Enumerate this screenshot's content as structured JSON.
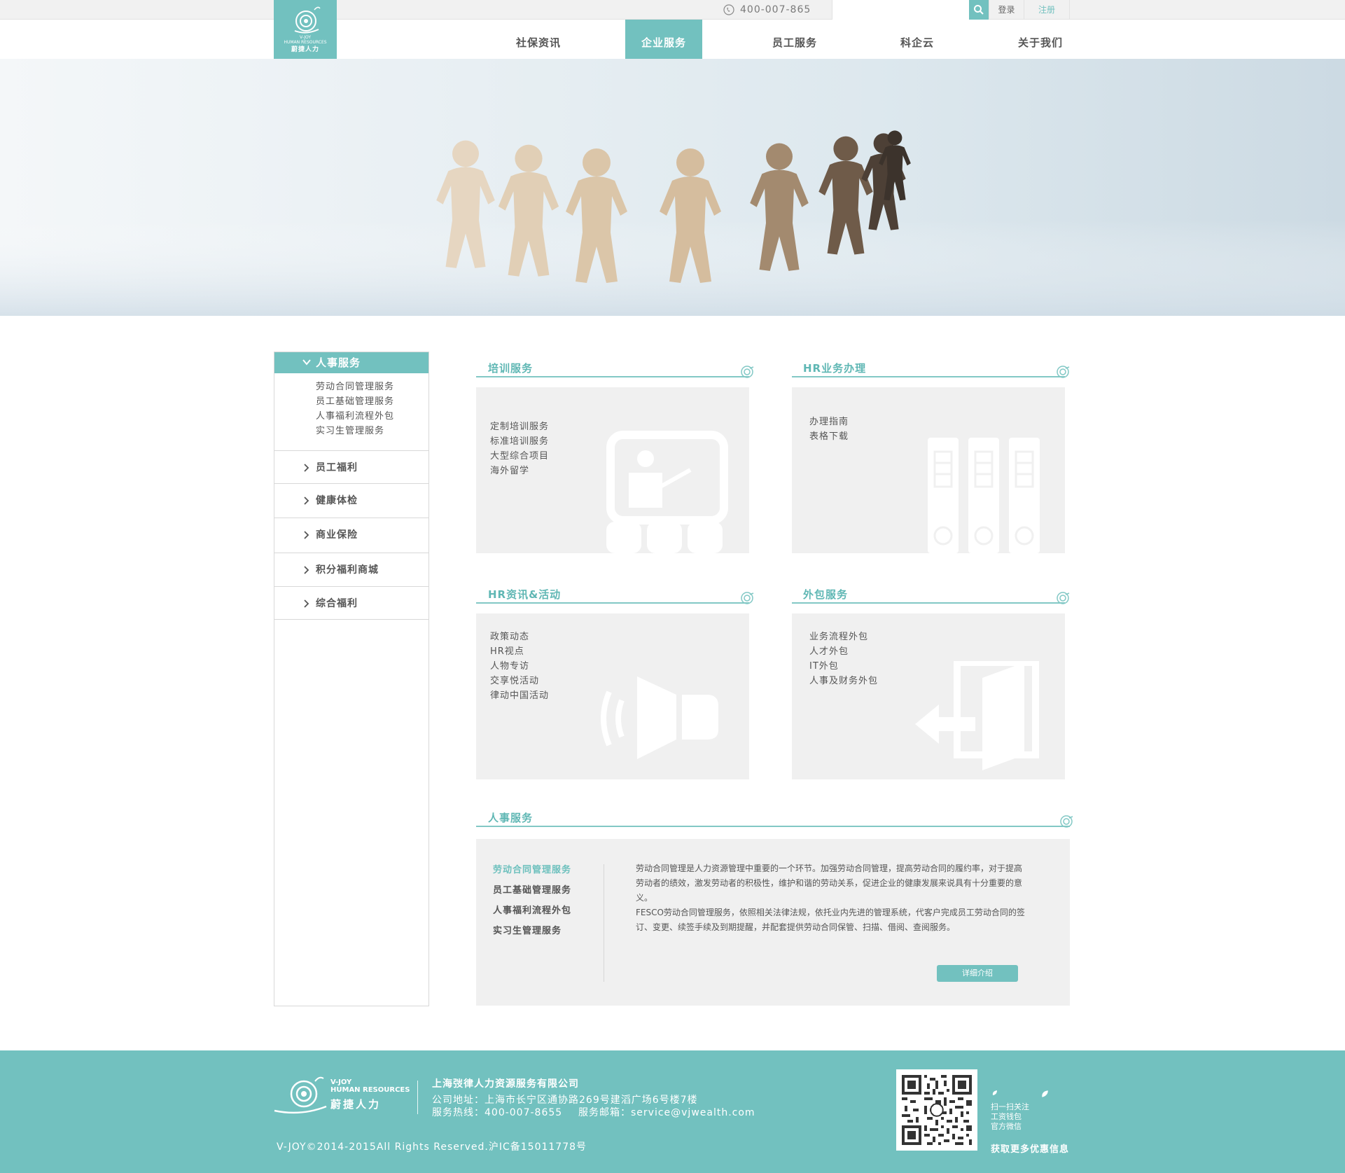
{
  "topbar": {
    "phone": "400-007-865",
    "search_placeholder": "",
    "login": "登录",
    "register": "注册"
  },
  "logo": {
    "brand_en": "V-JOY",
    "tagline_en": "HUMAN RESOURCES",
    "brand_cn": "蔚捷人力"
  },
  "nav": {
    "items": [
      {
        "label": "社保资讯"
      },
      {
        "label": "企业服务"
      },
      {
        "label": "员工服务"
      },
      {
        "label": "科企云"
      },
      {
        "label": "关于我们"
      }
    ],
    "active_index": 1
  },
  "sidebar": {
    "section": "人事服务",
    "subitems": [
      "劳动合同管理服务",
      "员工基础管理服务",
      "人事福利流程外包",
      "实习生管理服务"
    ],
    "items": [
      "员工福利",
      "健康体检",
      "商业保险",
      "积分福利商城",
      "综合福利"
    ]
  },
  "cards": [
    {
      "title": "培训服务",
      "links": [
        "定制培训服务",
        "标准培训服务",
        "大型综合项目",
        "海外留学"
      ],
      "icon": "presentation-board-icon"
    },
    {
      "title": "HR业务办理",
      "links": [
        "办理指南",
        "表格下载"
      ],
      "icon": "binders-icon"
    },
    {
      "title": "HR资讯&活动",
      "links": [
        "政策动态",
        "HR视点",
        "人物专访",
        "交享悦活动",
        "律动中国活动"
      ],
      "icon": "speaker-icon"
    },
    {
      "title": "外包服务",
      "links": [
        "业务流程外包",
        "人才外包",
        "IT外包",
        "人事及财务外包"
      ],
      "icon": "exit-door-icon"
    }
  ],
  "hr_detail": {
    "title": "人事服务",
    "tabs": [
      "劳动合同管理服务",
      "员工基础管理服务",
      "人事福利流程外包",
      "实习生管理服务"
    ],
    "active_tab": 0,
    "paragraph1": "劳动合同管理是人力资源管理中重要的一个环节。加强劳动合同管理，提高劳动合同的履约率，对于提高劳动者的绩效，激发劳动者的积极性，维护和谐的劳动关系，促进企业的健康发展来说具有十分重要的意义。",
    "paragraph2": "FESCO劳动合同管理服务，依照相关法律法规，依托业内先进的管理系统，代客户完成员工劳动合同的签订、变更、续签手续及到期提醒，并配套提供劳动合同保管、扫描、借阅、查阅服务。",
    "button": "详细介绍"
  },
  "footer": {
    "brand_en": "V-JOY",
    "tagline_en": "HUMAN RESOURCES",
    "brand_cn": "蔚捷人力",
    "company": "上海弢律人力资源服务有限公司",
    "address": "公司地址：上海市长宁区通协路269号建滔广场6号楼7楼",
    "hotline": "服务热线：400-007-8655",
    "email": "服务邮箱：service@vjwealth.com",
    "copyright": "V-JOY©2014-2015All Rights Reserved.沪IC备15011778号",
    "qr_text": [
      "扫一扫关注",
      "工资钱包",
      "官方微信"
    ],
    "more": "获取更多优惠信息"
  },
  "colors": {
    "accent": "#72c1bf",
    "accent_text": "#5fb7b4",
    "card_bg": "#f0f0f0",
    "text": "#555555"
  }
}
